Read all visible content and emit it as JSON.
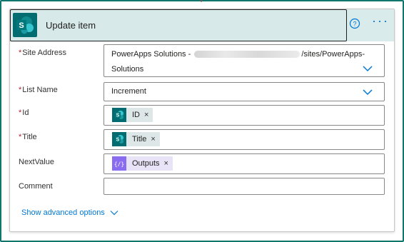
{
  "card": {
    "title": "Update item",
    "icon": "sharepoint-icon",
    "help_icon": "help-circle-icon",
    "more_icon": "more-ellipsis-icon",
    "more_label": "···"
  },
  "fields": {
    "site_address": {
      "label": "Site Address",
      "required": "*",
      "value_prefix": "PowerApps Solutions - ",
      "value_suffix": "/sites/PowerApps-",
      "value_line2": "Solutions",
      "redacted_url": "https://______.sharepoint.com"
    },
    "list_name": {
      "label": "List Name",
      "required": "*",
      "value": "Increment"
    },
    "id": {
      "label": "Id",
      "required": "*",
      "token": "ID",
      "token_icon": "sharepoint-icon"
    },
    "title": {
      "label": "Title",
      "required": "*",
      "token": "Title",
      "token_icon": "sharepoint-icon"
    },
    "next_value": {
      "label": "NextValue",
      "token": "Outputs",
      "token_icon": "expression-icon"
    },
    "comment": {
      "label": "Comment",
      "value": ""
    }
  },
  "token_close": "×",
  "advanced": {
    "label": "Show advanced options"
  },
  "colors": {
    "frame": "#0f766e",
    "header": "#d9ebea",
    "sharepoint": "#036c70",
    "expression": "#8a6cf0",
    "link": "#0078d4",
    "required": "#a4262c"
  }
}
